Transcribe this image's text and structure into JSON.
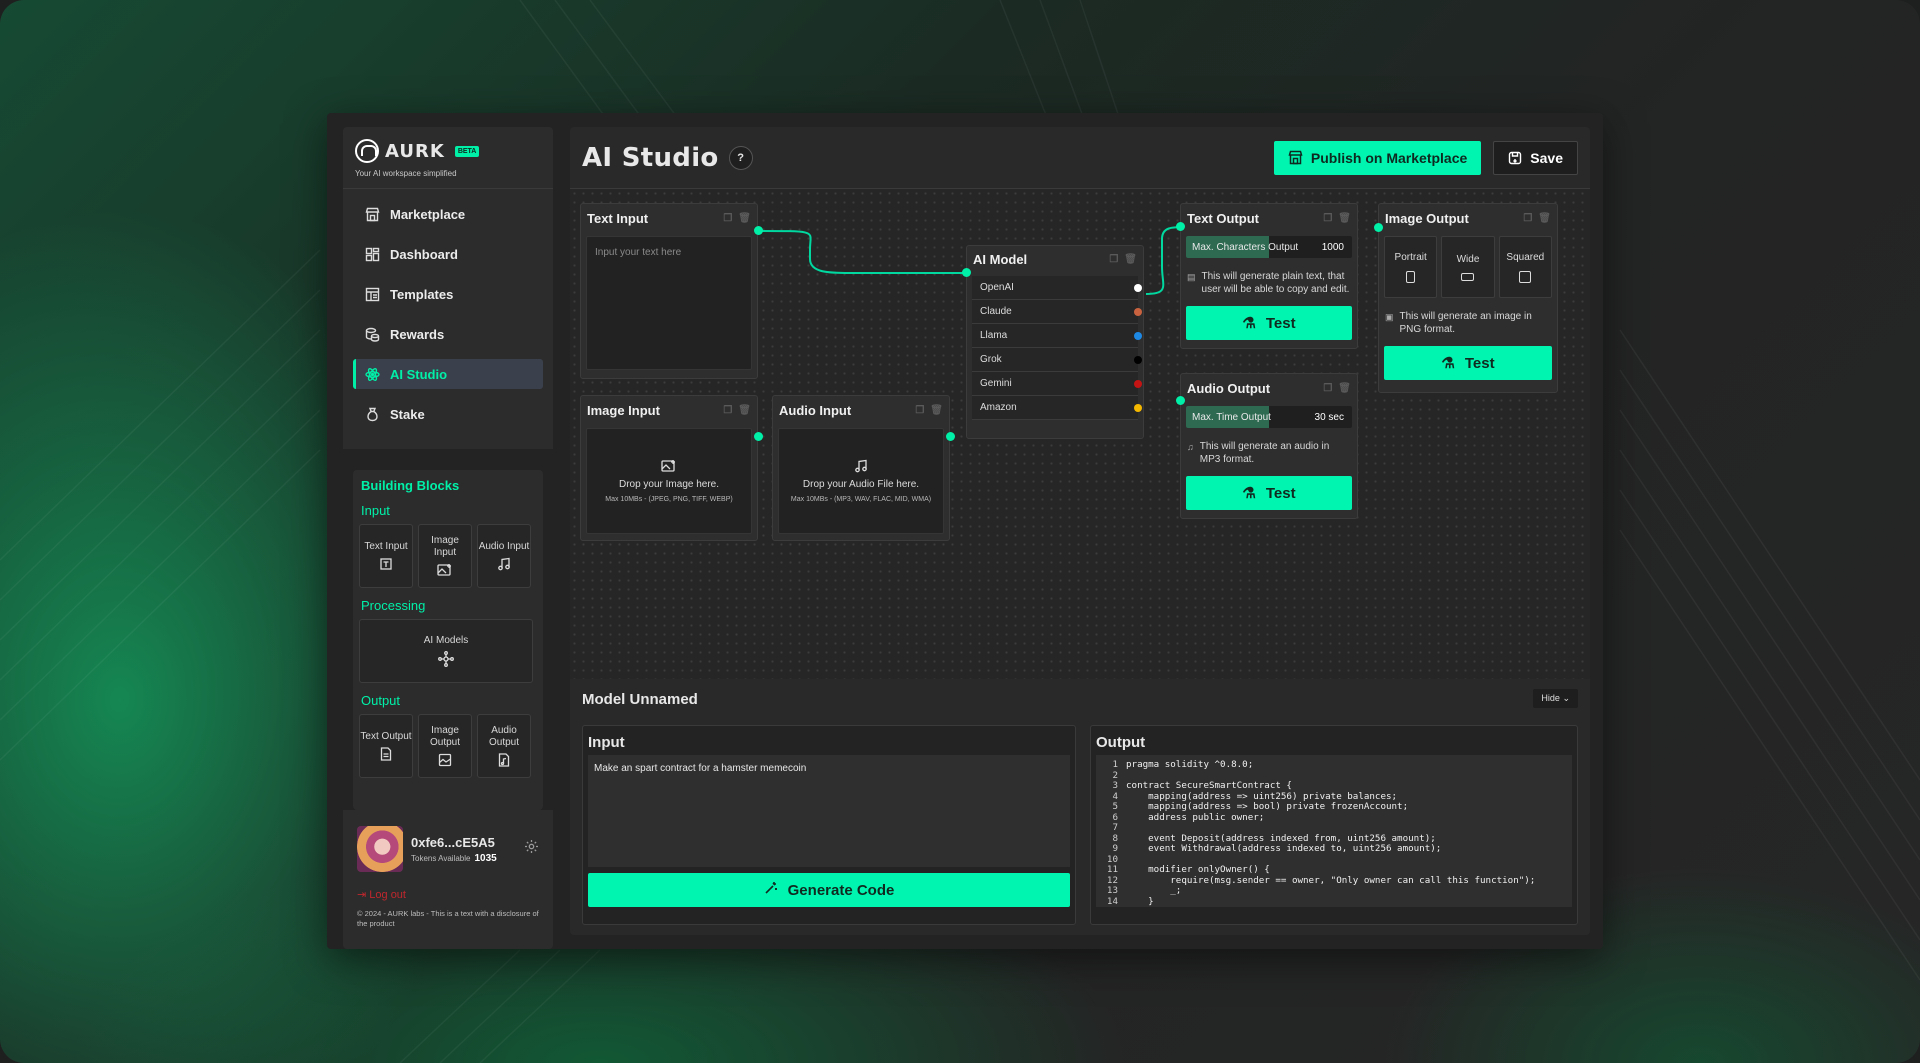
{
  "brand": {
    "name": "AURK",
    "badge": "BETA",
    "tagline": "Your AI workspace simplified"
  },
  "nav": [
    {
      "label": "Marketplace",
      "icon": "store-icon"
    },
    {
      "label": "Dashboard",
      "icon": "dashboard-icon"
    },
    {
      "label": "Templates",
      "icon": "templates-icon"
    },
    {
      "label": "Rewards",
      "icon": "coins-icon"
    },
    {
      "label": "AI Studio",
      "icon": "atom-icon",
      "active": true
    },
    {
      "label": "Stake",
      "icon": "money-bag-icon"
    }
  ],
  "blocks": {
    "title": "Building Blocks",
    "input_label": "Input",
    "input_tiles": [
      "Text Input",
      "Image Input",
      "Audio Input"
    ],
    "processing_label": "Processing",
    "processing_tile": "AI Models",
    "output_label": "Output",
    "output_tiles": [
      "Text Output",
      "Image Output",
      "Audio Output"
    ]
  },
  "user": {
    "wallet": "0xfe6...cE5A5",
    "tokens_label": "Tokens Available",
    "tokens": "1035",
    "logout": "Log out",
    "copyright": "© 2024 - AURK labs - This is a text with a disclosure of the product"
  },
  "header": {
    "title": "AI Studio",
    "help": "?",
    "publish": "Publish on Marketplace",
    "save": "Save"
  },
  "nodes": {
    "text_input": {
      "title": "Text Input",
      "placeholder": "Input your text here"
    },
    "image_input": {
      "title": "Image Input",
      "drop": "Drop your Image here.",
      "limits": "Max 10MBs - (JPEG, PNG, TIFF, WEBP)"
    },
    "audio_input": {
      "title": "Audio Input",
      "drop": "Drop your Audio File here.",
      "limits": "Max 10MBs - (MP3, WAV, FLAC, MID, WMA)"
    },
    "ai_model": {
      "title": "AI Model",
      "models": [
        {
          "name": "OpenAI",
          "color": "#ffffff"
        },
        {
          "name": "Claude",
          "color": "#c9633f"
        },
        {
          "name": "Llama",
          "color": "#1e88e5"
        },
        {
          "name": "Grok",
          "color": "#000000"
        },
        {
          "name": "Gemini",
          "color": "#c41414"
        },
        {
          "name": "Amazon",
          "color": "#f5b800"
        }
      ]
    },
    "text_output": {
      "title": "Text Output",
      "slider_label": "Max. Characters Output",
      "slider_value": "1000",
      "slider_fraction": 0.5,
      "note": "This will generate plain text, that user will be able to copy and edit.",
      "test": "Test"
    },
    "audio_output": {
      "title": "Audio Output",
      "slider_label": "Max. Time Output",
      "slider_value": "30 sec",
      "slider_fraction": 0.5,
      "note": "This will generate an audio in MP3 format.",
      "test": "Test"
    },
    "image_output": {
      "title": "Image Output",
      "formats": [
        "Portrait",
        "Wide",
        "Squared"
      ],
      "note": "This will generate an image in PNG format.",
      "test": "Test"
    }
  },
  "bottom": {
    "model_name": "Model Unnamed",
    "hide": "Hide",
    "input_title": "Input",
    "input_text": "Make an spart contract for a hamster memecoin",
    "generate": "Generate Code",
    "output_title": "Output",
    "code": [
      "pragma solidity ^0.8.0;",
      "",
      "contract SecureSmartContract {",
      "    mapping(address => uint256) private balances;",
      "    mapping(address => bool) private frozenAccount;",
      "    address public owner;",
      "",
      "    event Deposit(address indexed from, uint256 amount);",
      "    event Withdrawal(address indexed to, uint256 amount);",
      "",
      "    modifier onlyOwner() {",
      "        require(msg.sender == owner, \"Only owner can call this function\");",
      "        _;",
      "    }"
    ]
  }
}
